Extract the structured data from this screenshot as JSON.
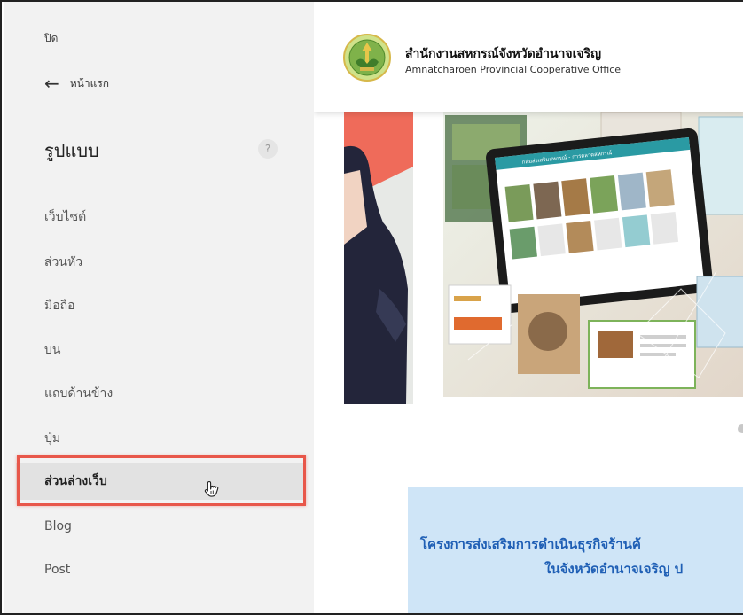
{
  "sidebar": {
    "close_label": "ปิด",
    "back_label": "หน้าแรก",
    "section_title": "รูปแบบ",
    "help_label": "?",
    "items": [
      {
        "label": "เว็บไซต์"
      },
      {
        "label": "ส่วนหัว"
      },
      {
        "label": "มือถือ"
      },
      {
        "label": "บน"
      },
      {
        "label": "แถบด้านข้าง"
      },
      {
        "label": "ปุ่ม"
      },
      {
        "label": "ส่วนล่างเว็บ"
      },
      {
        "label": "Blog"
      },
      {
        "label": "Post"
      }
    ],
    "active_item": "ส่วนล่างเว็บ"
  },
  "preview": {
    "org_name_th": "สำนักงานสหกรณ์จังหวัดอำนาจเจริญ",
    "org_name_en": "Amnatcharoen Provincial Cooperative Office",
    "tablet_header": "กลุ่มส่งเสริมสหกรณ์ - การตลาดสหกรณ์",
    "poster_line1": "โครงการส่งเสริมการดำเนินธุรกิจร้านค้",
    "poster_line2": "ในจังหวัดอำนาจเจริญ ป"
  },
  "colors": {
    "highlight": "#e8574a",
    "sidebar_bg": "#f2f2f2",
    "banner_accent": "#ef6b5a",
    "poster_text": "#1f5fb5"
  }
}
